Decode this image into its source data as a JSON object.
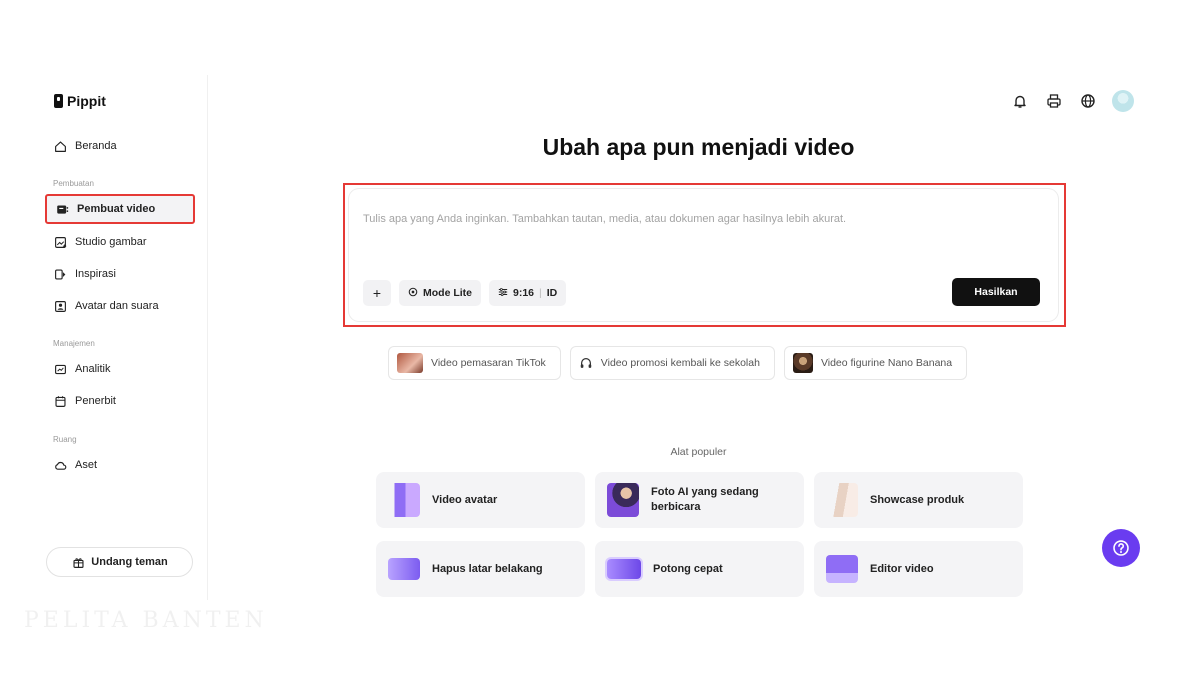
{
  "brand": {
    "name": "Pippit"
  },
  "sidebar": {
    "home": {
      "label": "Beranda",
      "icon": "home-icon"
    },
    "section_creation": "Pembuatan",
    "creation_items": [
      {
        "label": "Pembuat video",
        "icon": "video-maker-icon",
        "active": true
      },
      {
        "label": "Studio gambar",
        "icon": "image-studio-icon"
      },
      {
        "label": "Inspirasi",
        "icon": "inspiration-icon"
      },
      {
        "label": "Avatar dan suara",
        "icon": "avatar-voice-icon"
      }
    ],
    "section_management": "Manajemen",
    "management_items": [
      {
        "label": "Analitik",
        "icon": "analytics-icon"
      },
      {
        "label": "Penerbit",
        "icon": "publisher-icon"
      }
    ],
    "section_space": "Ruang",
    "space_items": [
      {
        "label": "Aset",
        "icon": "cloud-icon"
      }
    ],
    "invite_label": "Undang teman"
  },
  "header": {
    "icons": [
      "bell-icon",
      "printer-icon",
      "globe-icon",
      "avatar"
    ]
  },
  "main": {
    "headline": "Ubah apa pun menjadi video",
    "prompt": {
      "placeholder": "Tulis apa yang Anda inginkan. Tambahkan tautan, media, atau dokumen agar hasilnya lebih akurat.",
      "add_label": "+",
      "mode_label": "Mode Lite",
      "ratio_label": "9:16",
      "language_label": "ID",
      "generate_label": "Hasilkan"
    },
    "suggestions": [
      {
        "label": "Video pemasaran TikTok"
      },
      {
        "label": "Video promosi kembali ke sekolah"
      },
      {
        "label": "Video figurine Nano Banana"
      }
    ],
    "popular_label": "Alat populer",
    "tools": [
      {
        "label": "Video avatar"
      },
      {
        "label": "Foto AI yang sedang berbicara"
      },
      {
        "label": "Showcase produk"
      },
      {
        "label": "Hapus latar belakang"
      },
      {
        "label": "Potong cepat"
      },
      {
        "label": "Editor video"
      }
    ]
  },
  "watermark": "PELITA BANTEN",
  "colors": {
    "accent": "#6a3cf0",
    "highlight": "#e53935",
    "primary_button": "#111111"
  }
}
